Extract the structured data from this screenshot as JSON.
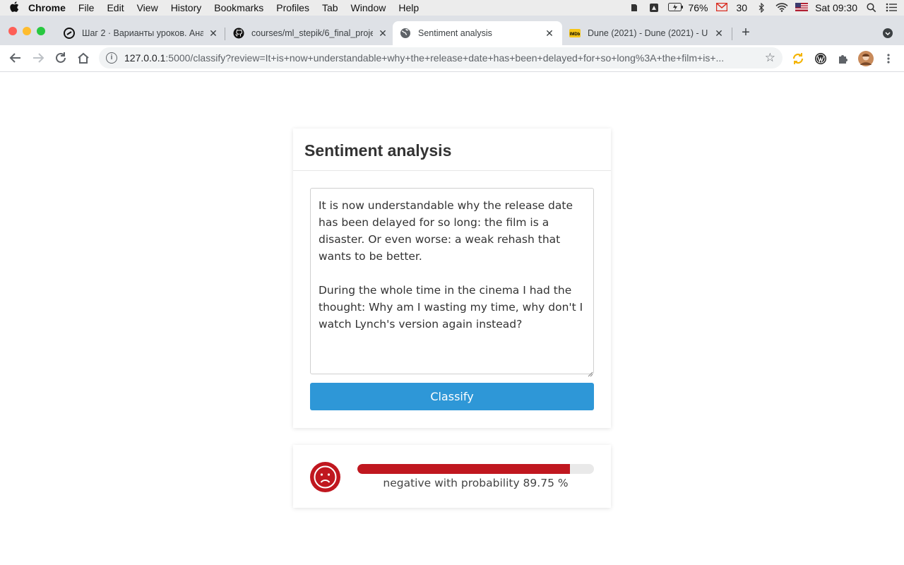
{
  "menubar": {
    "app": "Chrome",
    "items": [
      "File",
      "Edit",
      "View",
      "History",
      "Bookmarks",
      "Profiles",
      "Tab",
      "Window",
      "Help"
    ],
    "battery": "76%",
    "mail_count": "30",
    "clock": "Sat 09:30"
  },
  "tabs": [
    {
      "title": "Шаг 2 · Варианты уроков. Ана",
      "icon": "stepik-icon"
    },
    {
      "title": "courses/ml_stepik/6_final_proje",
      "icon": "github-icon"
    },
    {
      "title": "Sentiment analysis",
      "icon": "globe-icon",
      "active": true
    },
    {
      "title": "Dune (2021) - Dune (2021) - U",
      "icon": "imdb-icon"
    }
  ],
  "address": {
    "host": "127.0.0.1",
    "path": ":5000/classify?review=It+is+now+understandable+why+the+release+date+has+been+delayed+for+so+long%3A+the+film+is+..."
  },
  "page": {
    "title": "Sentiment analysis",
    "review_text": "It is now understandable why the release date has been delayed for so long: the film is a disaster. Or even worse: a weak rehash that wants to be better.\n\nDuring the whole time in the cinema I had the thought: Why am I wasting my time, why don't I watch Lynch's version again instead?",
    "button_label": "Classify"
  },
  "result": {
    "label": "negative",
    "probability": 89.75,
    "text": "negative with probability 89.75 %",
    "color": "#c0171f",
    "icon": "sad-face-icon"
  }
}
